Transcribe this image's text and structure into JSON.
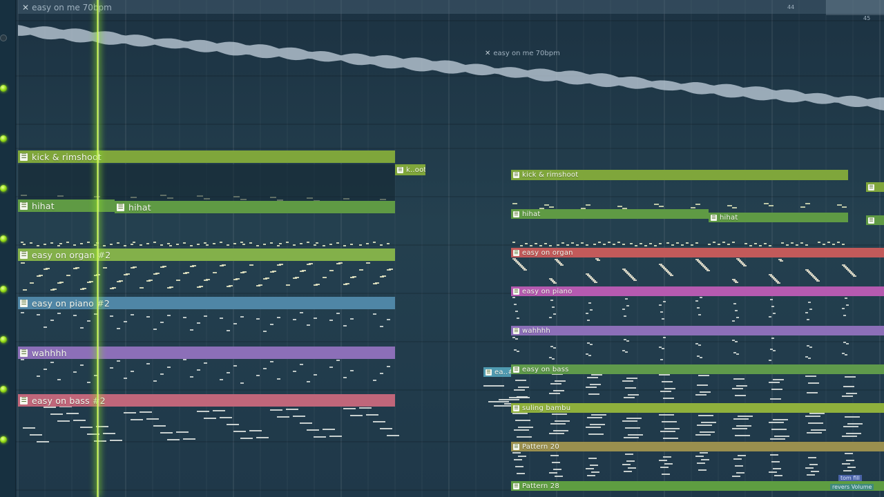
{
  "audio_clips": [
    {
      "close": "✕",
      "title": "easy on me 70bpm"
    },
    {
      "close": "✕",
      "title": "easy on me 70bpm"
    }
  ],
  "bar_numbers": [
    "44",
    "45"
  ],
  "patterns_left": {
    "kick": "kick & rimshoot",
    "kick_short": "k..oot",
    "hihat_a": "hihat",
    "hihat_b": "hihat",
    "organ": "easy on organ #2",
    "piano": "easy on piano #2",
    "wah": "wahhhh",
    "bass": "easy on bass #2"
  },
  "patterns_right": {
    "kick": "kick & rimshoot",
    "hihat_a": "hihat",
    "hihat_b": "hihat",
    "organ": "easy on organ",
    "piano": "easy on piano",
    "wah": "wahhhh",
    "bass_short": "ea..#3",
    "bass": "easy on bass",
    "suling": "suling bambu",
    "pattern20": "Pattern 20",
    "pattern28": "Pattern 28",
    "tom_fill": "tom fill",
    "revers": "revers Volume"
  },
  "colors": {
    "kick": "#7fa63b",
    "hihat": "#5f9a44",
    "organ_left": "#83b04a",
    "organ_right": "#c25a5a",
    "piano_left": "#4f86a6",
    "piano_right": "#b65ab0",
    "wah": "#8c6fb8",
    "bass_left": "#c0667a",
    "bass_right": "#5f9a4b",
    "suling": "#8fb03c",
    "pattern20": "#9a8f4e",
    "pattern28": "#5e9d41",
    "playhead": "#b8f23a"
  }
}
